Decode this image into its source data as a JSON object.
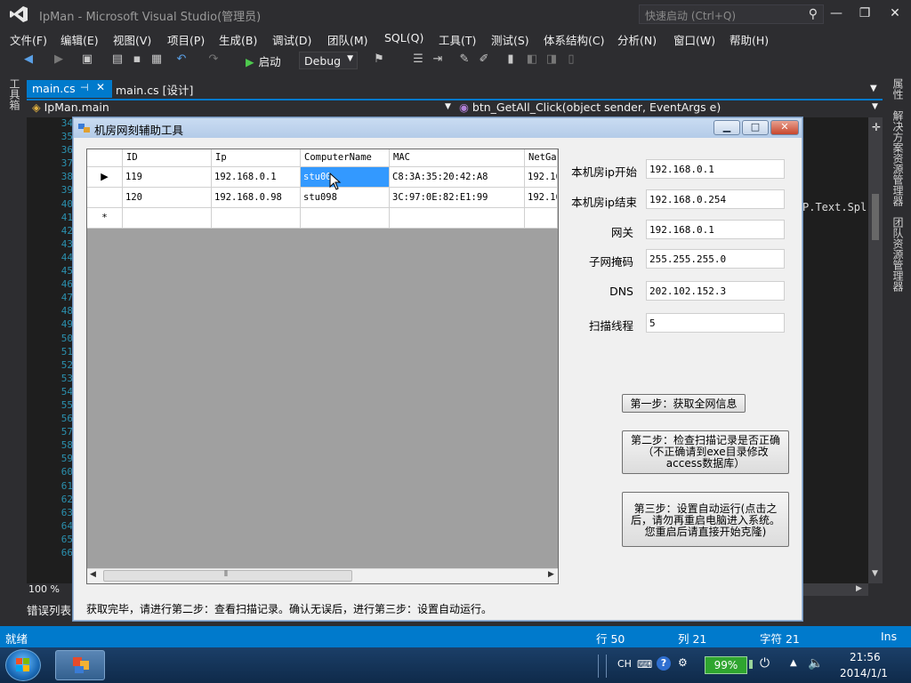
{
  "vs": {
    "title": "IpMan - Microsoft Visual Studio(管理员)",
    "quick_launch": "快速启动 (Ctrl+Q)",
    "menu": [
      "文件(F)",
      "编辑(E)",
      "视图(V)",
      "项目(P)",
      "生成(B)",
      "调试(D)",
      "团队(M)",
      "SQL(Q)",
      "工具(T)",
      "测试(S)",
      "体系结构(C)",
      "分析(N)",
      "窗口(W)",
      "帮助(H)"
    ],
    "toolbar": {
      "start": "启动",
      "config": "Debug"
    },
    "left_tab": "工具箱",
    "right_tabs": [
      "属性",
      "解决方案资源管理器",
      "团队资源管理器"
    ],
    "doc_tabs": {
      "active": "main.cs",
      "inactive": "main.cs [设计]"
    },
    "nav": {
      "class": "IpMan.main",
      "member": "btn_GetAll_Click(object sender, EventArgs e)"
    },
    "line_numbers": [
      "34",
      "35",
      "36",
      "37",
      "38",
      "39",
      "40",
      "41",
      "42",
      "43",
      "44",
      "45",
      "46",
      "47",
      "48",
      "49",
      "50",
      "51",
      "52",
      "53",
      "54",
      "55",
      "56",
      "57",
      "58",
      "59",
      "60",
      "61",
      "62",
      "63",
      "64",
      "65",
      "66"
    ],
    "code_fragment": "P.Text.Spl:",
    "zoom": "100 %",
    "error_list": "错误列表",
    "status": {
      "ready": "就绪",
      "line": "行 50",
      "col": "列 21",
      "char": "字符 21",
      "mode": "Ins"
    }
  },
  "dialog": {
    "title": "机房网刻辅助工具",
    "grid": {
      "columns": [
        "ID",
        "Ip",
        "ComputerName",
        "MAC",
        "NetGa"
      ],
      "rows": [
        [
          "119",
          "192.168.0.1",
          "stu00",
          "C8:3A:35:20:42:A8",
          "192.16"
        ],
        [
          "120",
          "192.168.0.98",
          "stu098",
          "3C:97:0E:82:E1:99",
          "192.16"
        ]
      ],
      "new_row_marker": "*",
      "current_row_marker": "▶"
    },
    "fields": [
      {
        "label": "本机房ip开始",
        "value": "192.168.0.1"
      },
      {
        "label": "本机房ip结束",
        "value": "192.168.0.254"
      },
      {
        "label": "网关",
        "value": "192.168.0.1"
      },
      {
        "label": "子网掩码",
        "value": "255.255.255.0"
      },
      {
        "label": "DNS",
        "value": "202.102.152.3"
      },
      {
        "label": "扫描线程",
        "value": "5"
      }
    ],
    "buttons": {
      "step1": "第一步：获取全网信息",
      "step2": "第二步：检查扫描记录是否正确（不正确请到exe目录修改access数据库）",
      "step3": "第三步：设置自动运行(点击之后，请勿再重启电脑进入系统。您重启后请直接开始克隆)"
    },
    "message": "获取完毕，请进行第二步：查看扫描记录。确认无误后，进行第三步：设置自动运行。"
  },
  "taskbar": {
    "lang": "CH",
    "battery": "99%",
    "time": "21:56",
    "date": "2014/1/1"
  }
}
